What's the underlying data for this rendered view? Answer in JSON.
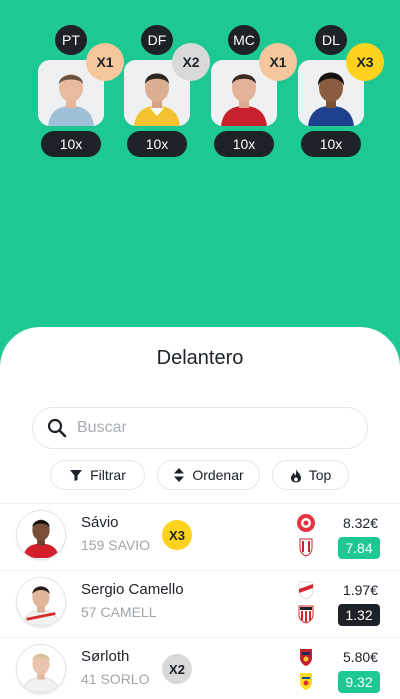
{
  "colors": {
    "background": "#1ec893",
    "dark": "#1c2228",
    "mult_x1": "#f6c79c",
    "mult_x2": "#d9d9d9",
    "mult_x3": "#ffd21e",
    "score_green": "#1ec893",
    "score_dark": "#1c2228"
  },
  "lineup": [
    {
      "position": "PT",
      "multiplier": "X1",
      "multiplier_color": "#f6c79c",
      "count": "10x"
    },
    {
      "position": "DF",
      "multiplier": "X2",
      "multiplier_color": "#d9d9d9",
      "count": "10x"
    },
    {
      "position": "MC",
      "multiplier": "X1",
      "multiplier_color": "#f6c79c",
      "count": "10x"
    },
    {
      "position": "DL",
      "multiplier": "X3",
      "multiplier_color": "#ffd21e",
      "count": "10x"
    }
  ],
  "sheet": {
    "title": "Delantero",
    "search_placeholder": "Buscar",
    "search_icon": "search-icon",
    "filters": [
      {
        "label": "Filtrar",
        "icon": "funnel-icon"
      },
      {
        "label": "Ordenar",
        "icon": "sort-arrows-icon"
      },
      {
        "label": "Top",
        "icon": "flame-icon"
      }
    ]
  },
  "players": [
    {
      "name": "Sávio",
      "code": "159 SAVIO",
      "multiplier": "X3",
      "multiplier_color": "#ffd21e",
      "price": "8.32€",
      "score": "7.84",
      "score_color": "#1ec893",
      "home_crest": "girona-crest-icon",
      "away_crest": "granada-crest-icon"
    },
    {
      "name": "Sergio Camello",
      "code": "57 CAMELL",
      "multiplier": "",
      "multiplier_color": "",
      "price": "1.97€",
      "score": "1.32",
      "score_color": "#1c2228",
      "home_crest": "rayo-crest-icon",
      "away_crest": "athletic-crest-icon"
    },
    {
      "name": "Sørloth",
      "code": "41 SORLO",
      "multiplier": "X2",
      "multiplier_color": "#d9d9d9",
      "price": "5.80€",
      "score": "9.32",
      "score_color": "#1ec893",
      "home_crest": "osasuna-crest-icon",
      "away_crest": "villarreal-crest-icon"
    }
  ]
}
